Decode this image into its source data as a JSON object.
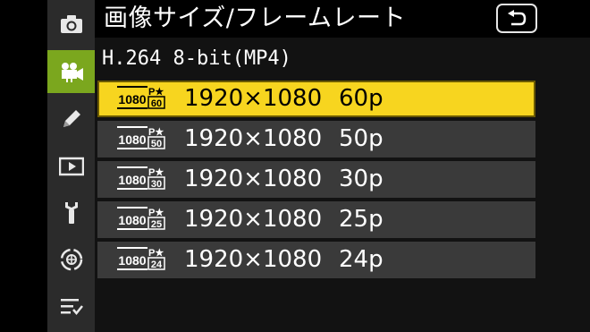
{
  "header": {
    "title": "画像サイズ/フレームレート",
    "back_icon": "return-arrow-icon"
  },
  "sidebar": {
    "items": [
      {
        "icon": "camera-icon",
        "active": false
      },
      {
        "icon": "movie-camera-icon",
        "active": true
      },
      {
        "icon": "pencil-icon",
        "active": false
      },
      {
        "icon": "playback-icon",
        "active": false
      },
      {
        "icon": "wrench-icon",
        "active": false
      },
      {
        "icon": "network-icon",
        "active": false
      },
      {
        "icon": "my-menu-icon",
        "active": false
      }
    ]
  },
  "subheader": {
    "label": "H.264 8-bit(MP4)"
  },
  "options": [
    {
      "badge": "1080",
      "badge_fps": "60",
      "resolution": "1920×1080",
      "fps": "60p",
      "selected": true
    },
    {
      "badge": "1080",
      "badge_fps": "50",
      "resolution": "1920×1080",
      "fps": "50p",
      "selected": false
    },
    {
      "badge": "1080",
      "badge_fps": "30",
      "resolution": "1920×1080",
      "fps": "30p",
      "selected": false
    },
    {
      "badge": "1080",
      "badge_fps": "25",
      "resolution": "1920×1080",
      "fps": "25p",
      "selected": false
    },
    {
      "badge": "1080",
      "badge_fps": "24",
      "resolution": "1920×1080",
      "fps": "24p",
      "selected": false
    }
  ],
  "colors": {
    "accent_green": "#7ba71e",
    "selection_yellow": "#f7d51f",
    "row_gray": "#3a3a3a"
  }
}
